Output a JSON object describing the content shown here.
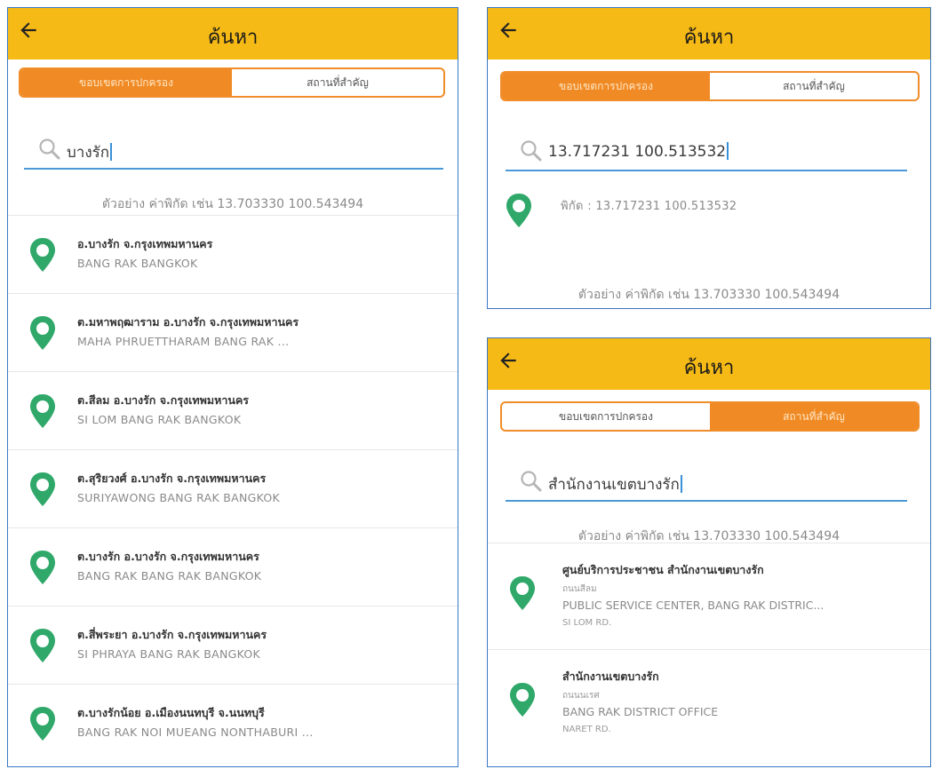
{
  "screens": {
    "left": {
      "title": "ค้นหา",
      "tabs": [
        {
          "label": "ขอบเขตการปกครอง",
          "active": true
        },
        {
          "label": "สถานที่สำคัญ",
          "active": false
        }
      ],
      "search_value": "บางรัก",
      "hint": "ตัวอย่าง ค่าพิกัด เช่น 13.703330 100.543494",
      "results": [
        {
          "th": "อ.บางรัก จ.กรุงเทพมหานคร",
          "en": "BANG RAK  BANGKOK"
        },
        {
          "th": "ต.มหาพฤฒาราม อ.บางรัก จ.กรุงเทพมหานคร",
          "en": "MAHA PHRUETTHARAM  BANG RAK ..."
        },
        {
          "th": "ต.สีลม อ.บางรัก จ.กรุงเทพมหานคร",
          "en": "SI LOM  BANG RAK  BANGKOK"
        },
        {
          "th": "ต.สุริยวงศ์ อ.บางรัก จ.กรุงเทพมหานคร",
          "en": "SURIYAWONG  BANG RAK  BANGKOK"
        },
        {
          "th": "ต.บางรัก อ.บางรัก จ.กรุงเทพมหานคร",
          "en": "BANG RAK  BANG RAK  BANGKOK"
        },
        {
          "th": "ต.สี่พระยา อ.บางรัก จ.กรุงเทพมหานคร",
          "en": "SI PHRAYA  BANG RAK  BANGKOK"
        },
        {
          "th": "ต.บางรักน้อย อ.เมืองนนทบุรี จ.นนทบุรี",
          "en": "BANG RAK NOI  MUEANG NONTHABURI ..."
        }
      ]
    },
    "top_right": {
      "title": "ค้นหา",
      "tabs": [
        {
          "label": "ขอบเขตการปกครอง",
          "active": true
        },
        {
          "label": "สถานที่สำคัญ",
          "active": false
        }
      ],
      "search_value": "13.717231 100.513532",
      "results": [
        {
          "text": "พิกัด : 13.717231 100.513532"
        }
      ],
      "hint": "ตัวอย่าง ค่าพิกัด เช่น 13.703330 100.543494"
    },
    "bottom_right": {
      "title": "ค้นหา",
      "tabs": [
        {
          "label": "ขอบเขตการปกครอง",
          "active": false
        },
        {
          "label": "สถานที่สำคัญ",
          "active": true
        }
      ],
      "search_value": "สำนักงานเขตบางรัก",
      "hint": "ตัวอย่าง ค่าพิกัด เช่น 13.703330 100.543494",
      "results": [
        {
          "th": "ศูนย์บริการประชาชน สำนักงานเขตบางรัก",
          "road_th": "ถนนสีลม",
          "en": "PUBLIC SERVICE CENTER, BANG RAK DISTRIC...",
          "road_en": "SI LOM RD."
        },
        {
          "th": "สำนักงานเขตบางรัก",
          "road_th": "ถนนนเรศ",
          "en": "BANG RAK DISTRICT OFFICE",
          "road_en": "NARET RD."
        }
      ]
    }
  },
  "colors": {
    "appbar": "#f6ba16",
    "tab_active": "#f08a24",
    "pin": "#2fa86a",
    "underline": "#4a98d8",
    "frame": "#3a78c3"
  },
  "icons": [
    "back-arrow-icon",
    "search-icon",
    "map-pin-icon"
  ]
}
